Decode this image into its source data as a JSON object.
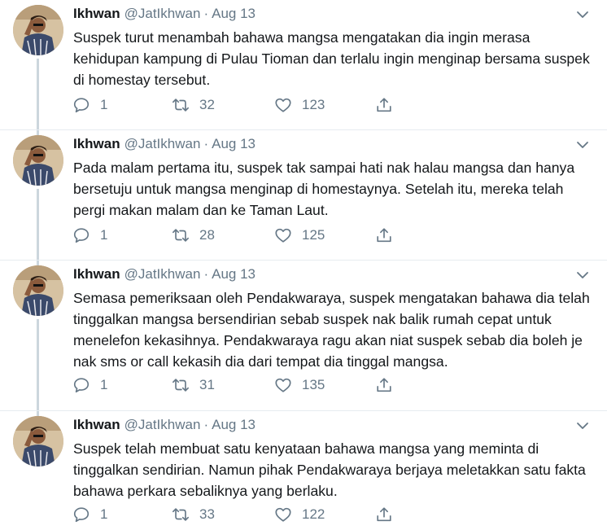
{
  "tweets": [
    {
      "author": "Ikhwan",
      "handle": "@JatIkhwan",
      "sep": "·",
      "date": "Aug 13",
      "text": "Suspek turut menambah bahawa mangsa mengatakan dia ingin merasa kehidupan kampung di Pulau Tioman dan terlalu ingin menginap bersama suspek di homestay tersebut.",
      "replies": "1",
      "retweets": "32",
      "likes": "123"
    },
    {
      "author": "Ikhwan",
      "handle": "@JatIkhwan",
      "sep": "·",
      "date": "Aug 13",
      "text": "Pada malam pertama itu, suspek tak sampai hati nak halau mangsa dan hanya bersetuju untuk mangsa menginap di homestaynya. Setelah itu, mereka telah pergi makan malam dan ke Taman Laut.",
      "replies": "1",
      "retweets": "28",
      "likes": "125"
    },
    {
      "author": "Ikhwan",
      "handle": "@JatIkhwan",
      "sep": "·",
      "date": "Aug 13",
      "text": "Semasa pemeriksaan oleh Pendakwaraya, suspek mengatakan bahawa dia telah tinggalkan mangsa bersendirian sebab suspek nak balik rumah cepat untuk menelefon kekasihnya. Pendakwaraya ragu akan niat suspek sebab dia boleh je nak sms or call kekasih dia dari tempat dia tinggal mangsa.",
      "replies": "1",
      "retweets": "31",
      "likes": "135"
    },
    {
      "author": "Ikhwan",
      "handle": "@JatIkhwan",
      "sep": "·",
      "date": "Aug 13",
      "text": "Suspek telah membuat satu kenyataan bahawa mangsa yang meminta di tinggalkan sendirian. Namun pihak Pendakwaraya berjaya meletakkan satu fakta bahawa perkara sebaliknya yang berlaku.",
      "replies": "1",
      "retweets": "33",
      "likes": "122"
    }
  ],
  "icons": {
    "reply": "reply-icon",
    "retweet": "retweet-icon",
    "like": "heart-icon",
    "share": "share-icon",
    "more": "chevron-down-icon"
  },
  "colors": {
    "text": "#14171a",
    "muted": "#657786",
    "thread_line": "#ccd6dd",
    "divider": "#e6ecf0"
  }
}
